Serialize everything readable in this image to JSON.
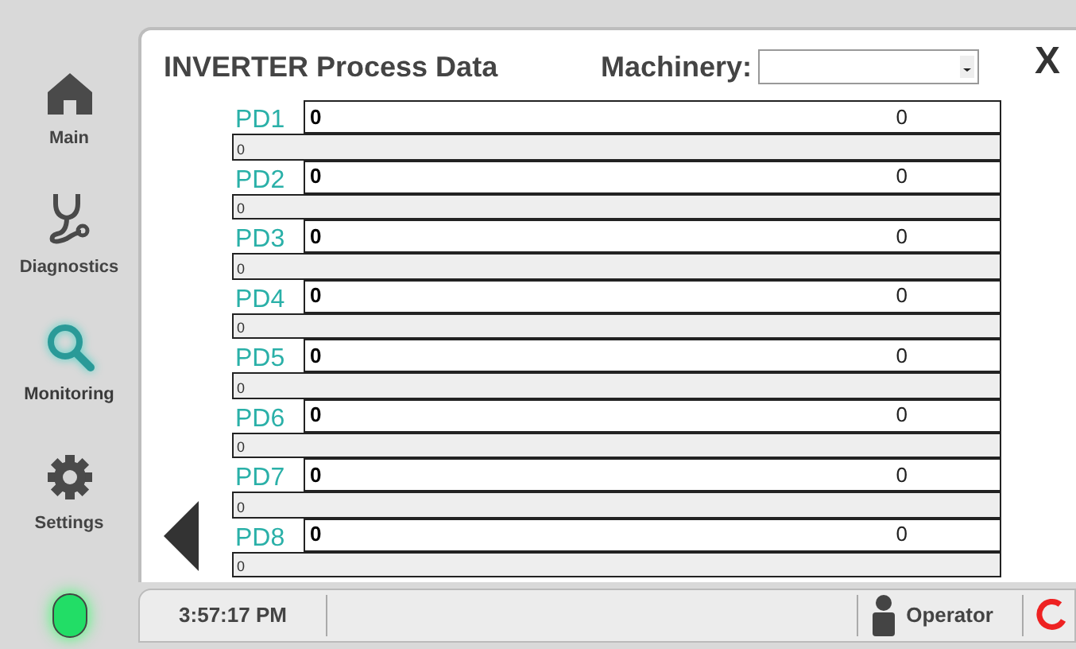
{
  "sidebar": {
    "items": [
      {
        "label": "Main",
        "selected": false
      },
      {
        "label": "Diagnostics",
        "selected": false
      },
      {
        "label": "Monitoring",
        "selected": true
      },
      {
        "label": "Settings",
        "selected": false
      }
    ],
    "status_led": {
      "on": true
    }
  },
  "panel": {
    "title": "INVERTER Process Data",
    "machinery_label": "Machinery:",
    "close": "X",
    "rows": [
      {
        "label": "PD1",
        "value": "0",
        "reading": "0",
        "bar_text": "0"
      },
      {
        "label": "PD2",
        "value": "0",
        "reading": "0",
        "bar_text": "0"
      },
      {
        "label": "PD3",
        "value": "0",
        "reading": "0",
        "bar_text": "0"
      },
      {
        "label": "PD4",
        "value": "0",
        "reading": "0",
        "bar_text": "0"
      },
      {
        "label": "PD5",
        "value": "0",
        "reading": "0",
        "bar_text": "0"
      },
      {
        "label": "PD6",
        "value": "0",
        "reading": "0",
        "bar_text": "0"
      },
      {
        "label": "PD7",
        "value": "0",
        "reading": "0",
        "bar_text": "0"
      },
      {
        "label": "PD8",
        "value": "0",
        "reading": "0",
        "bar_text": "0"
      }
    ]
  },
  "status_bar": {
    "time": "3:57:17 PM",
    "user": "Operator"
  }
}
